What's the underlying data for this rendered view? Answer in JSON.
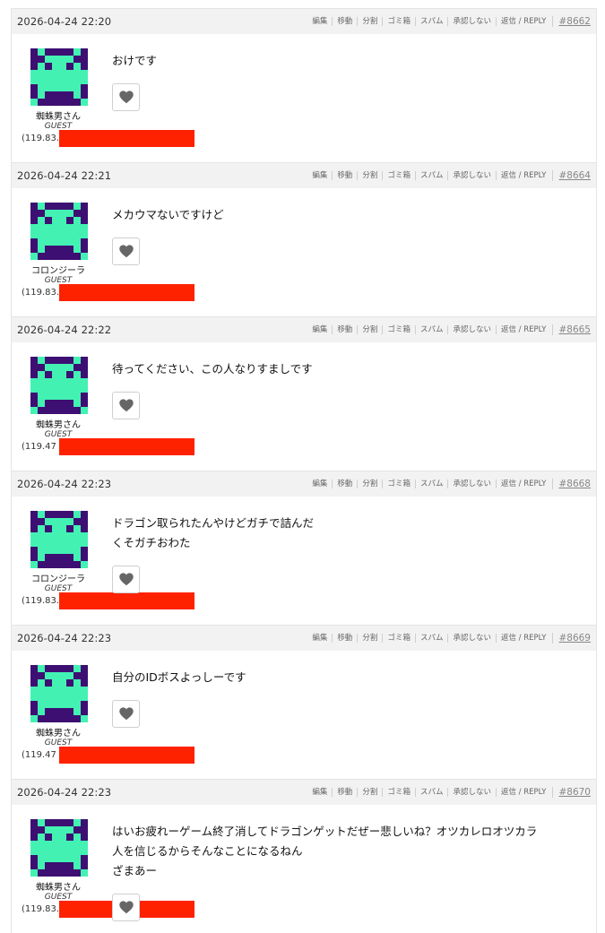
{
  "actions": {
    "edit": "編集",
    "move": "移動",
    "split": "分割",
    "trash": "ゴミ箱",
    "spam": "スパム",
    "unapprove": "承認しない",
    "reply": "返信 / REPLY"
  },
  "colors": {
    "avatar_bg": "#3d0f72",
    "avatar_fg": "#43f2b3",
    "redaction": "#ff2200"
  },
  "icons": {
    "like": "heart-icon",
    "avatar": "space-invader-avatar"
  },
  "posts": [
    {
      "time": "2026-04-24 22:20",
      "number": "#8662",
      "author": "蜘蛛男さん",
      "role": "GUEST",
      "ip": "(119.83.",
      "message": "おけです"
    },
    {
      "time": "2026-04-24 22:21",
      "number": "#8664",
      "author": "コロンジーラ",
      "role": "GUEST",
      "ip": "(119.83.",
      "message": "メカウマないですけど"
    },
    {
      "time": "2026-04-24 22:22",
      "number": "#8665",
      "author": "蜘蛛男さん",
      "role": "GUEST",
      "ip": "(119.47",
      "message": "待ってください、この人なりすましです"
    },
    {
      "time": "2026-04-24 22:23",
      "number": "#8668",
      "author": "コロンジーラ",
      "role": "GUEST",
      "ip": "(119.83.",
      "message": "ドラゴン取られたんやけどガチで詰んだ\nくそガチおわた"
    },
    {
      "time": "2026-04-24 22:23",
      "number": "#8669",
      "author": "蜘蛛男さん",
      "role": "GUEST",
      "ip": "(119.47",
      "message": "自分のIDボスよっしーです"
    },
    {
      "time": "2026-04-24 22:23",
      "number": "#8670",
      "author": "蜘蛛男さん",
      "role": "GUEST",
      "ip": "(119.83.",
      "message": "はいお疲れーゲーム終了消してドラゴンゲットだぜー悲しいね？オツカレロオツカラ\n人を信じるからそんなことになるねん\nざまあー"
    }
  ]
}
